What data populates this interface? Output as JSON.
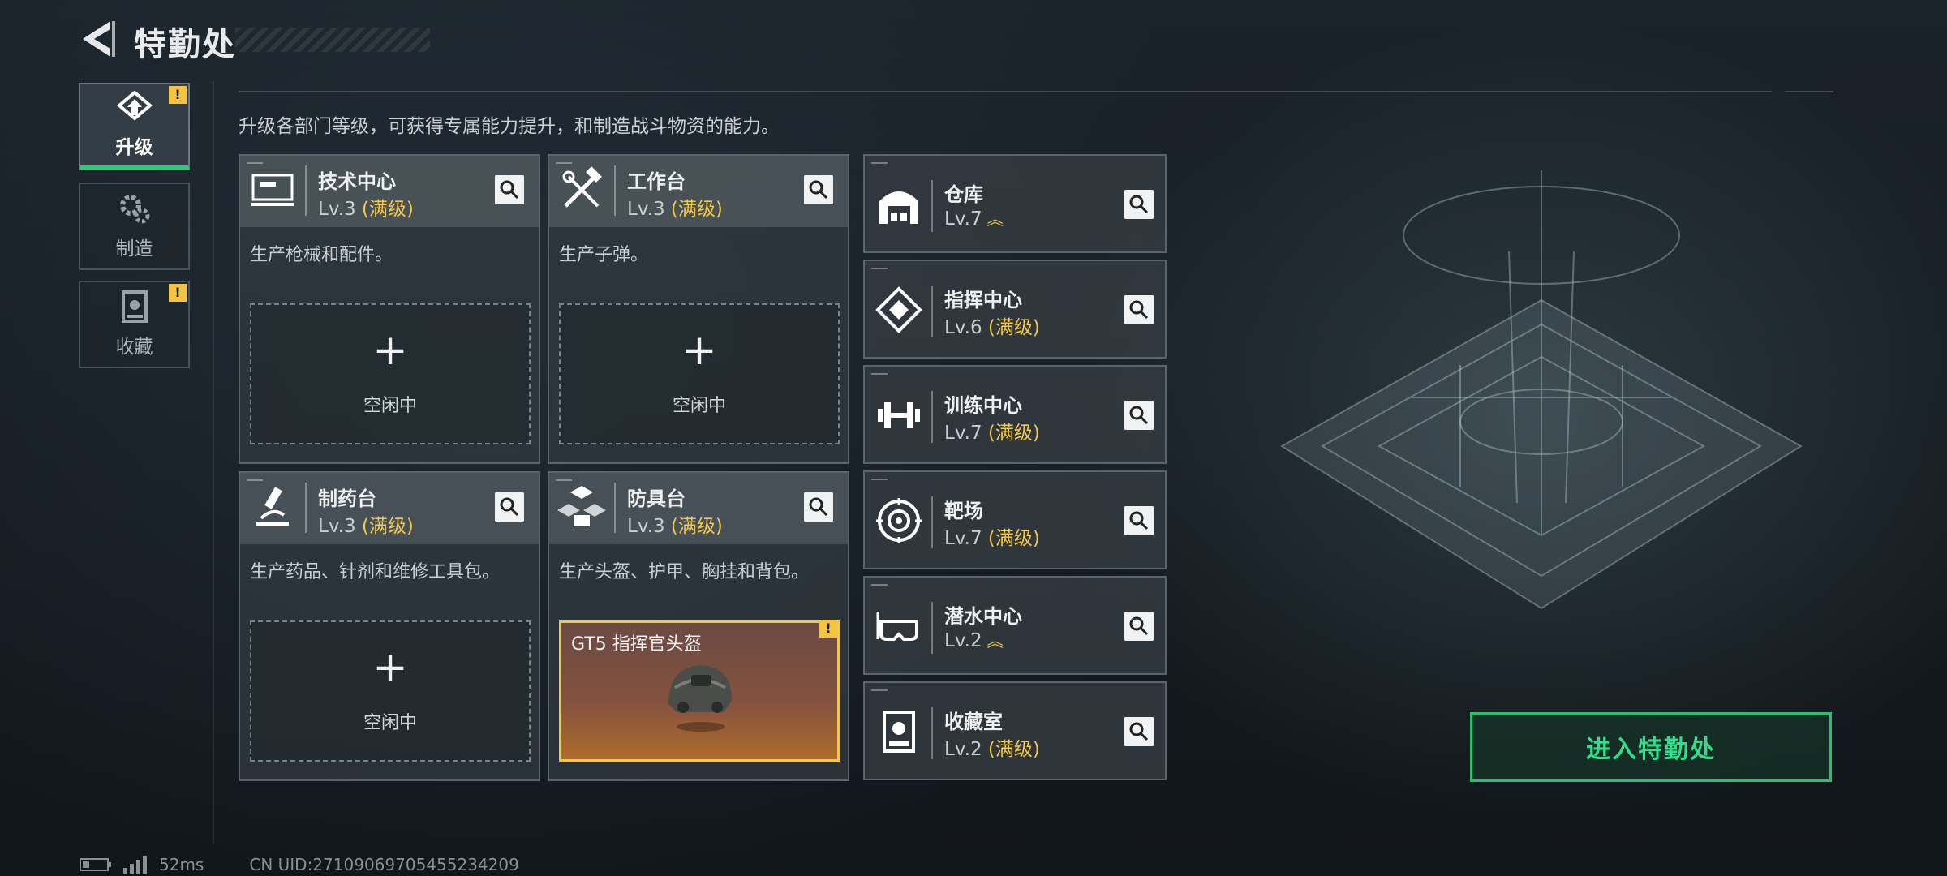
{
  "header": {
    "title": "特勤处"
  },
  "nav": {
    "tabs": [
      {
        "label": "升级",
        "active": true,
        "alert": "!"
      },
      {
        "label": "制造",
        "active": false
      },
      {
        "label": "收藏",
        "active": false,
        "alert": "!"
      }
    ]
  },
  "description": "升级各部门等级，可获得专属能力提升，和制造战斗物资的能力。",
  "cards": [
    {
      "name": "技术中心",
      "level": "Lv.3",
      "max": "(满级)",
      "desc": "生产枪械和配件。",
      "slot": {
        "type": "idle",
        "plus": "+",
        "text": "空闲中"
      },
      "icon": "computer-icon"
    },
    {
      "name": "工作台",
      "level": "Lv.3",
      "max": "(满级)",
      "desc": "生产子弹。",
      "slot": {
        "type": "idle",
        "plus": "+",
        "text": "空闲中"
      },
      "icon": "tools-icon"
    },
    {
      "name": "制药台",
      "level": "Lv.3",
      "max": "(满级)",
      "desc": "生产药品、针剂和维修工具包。",
      "slot": {
        "type": "idle",
        "plus": "+",
        "text": "空闲中"
      },
      "icon": "microscope-icon"
    },
    {
      "name": "防具台",
      "level": "Lv.3",
      "max": "(满级)",
      "desc": "生产头盔、护甲、胸挂和背包。",
      "slot": {
        "type": "item",
        "item_name": "GT5 指挥官头盔",
        "alert": "!"
      },
      "icon": "armor-icon"
    }
  ],
  "small_cards": [
    {
      "name": "仓库",
      "level": "Lv.7",
      "max": "",
      "upgrade": "︽",
      "icon": "warehouse-icon"
    },
    {
      "name": "指挥中心",
      "level": "Lv.6",
      "max": "(满级)",
      "upgrade": "",
      "icon": "command-icon"
    },
    {
      "name": "训练中心",
      "level": "Lv.7",
      "max": "(满级)",
      "upgrade": "",
      "icon": "dumbbell-icon"
    },
    {
      "name": "靶场",
      "level": "Lv.7",
      "max": "(满级)",
      "upgrade": "",
      "icon": "target-icon"
    },
    {
      "name": "潜水中心",
      "level": "Lv.2",
      "max": "",
      "upgrade": "︽",
      "icon": "diving-mask-icon"
    },
    {
      "name": "收藏室",
      "level": "Lv.2",
      "max": "(满级)",
      "upgrade": "",
      "icon": "collection-icon"
    }
  ],
  "enter_button": "进入特勤处",
  "footer": {
    "ping": "52ms",
    "uid": "CN UID:27109069705455234209"
  },
  "colors": {
    "accent_green": "#23c36e",
    "max_yellow": "#f2c94c",
    "alert_yellow": "#f5c542"
  }
}
